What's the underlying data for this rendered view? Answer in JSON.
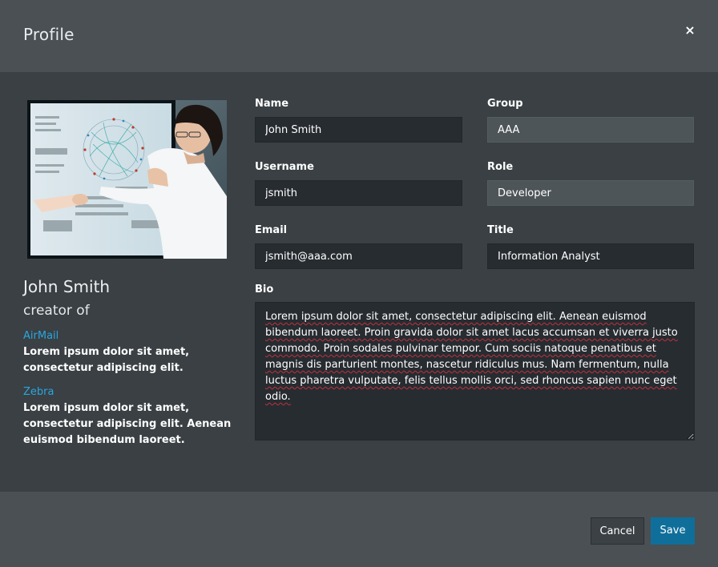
{
  "dialog": {
    "title": "Profile",
    "close_label": "×"
  },
  "profile": {
    "display_name": "John Smith",
    "creator_label": "creator of",
    "apps": [
      {
        "name": "AirMail",
        "description": "Lorem ipsum dolor sit amet, consectetur adipiscing elit."
      },
      {
        "name": "Zebra",
        "description": "Lorem ipsum dolor sit amet, consectetur adipiscing elit. Aenean euismod bibendum laoreet."
      }
    ]
  },
  "form": {
    "name": {
      "label": "Name",
      "value": "John Smith"
    },
    "group": {
      "label": "Group",
      "value": "AAA"
    },
    "username": {
      "label": "Username",
      "value": "jsmith"
    },
    "role": {
      "label": "Role",
      "value": "Developer"
    },
    "email": {
      "label": "Email",
      "value": "jsmith@aaa.com"
    },
    "title": {
      "label": "Title",
      "value": "Information Analyst"
    },
    "bio": {
      "label": "Bio",
      "value": "Lorem ipsum dolor sit amet, consectetur adipiscing elit. Aenean euismod bibendum laoreet. Proin gravida dolor sit amet lacus accumsan et viverra justo commodo. Proin sodales pulvinar tempor. Cum sociis natoque penatibus et magnis dis parturient montes, nascetur ridiculus mus. Nam fermentum, nulla luctus pharetra vulputate, felis tellus mollis orci, sed rhoncus sapien nunc eget odio."
    }
  },
  "footer": {
    "cancel_label": "Cancel",
    "save_label": "Save"
  },
  "colors": {
    "header_bg": "#4a5054",
    "body_bg": "#3a4044",
    "link": "#2aa6df",
    "save_button": "#0f6f9a"
  }
}
